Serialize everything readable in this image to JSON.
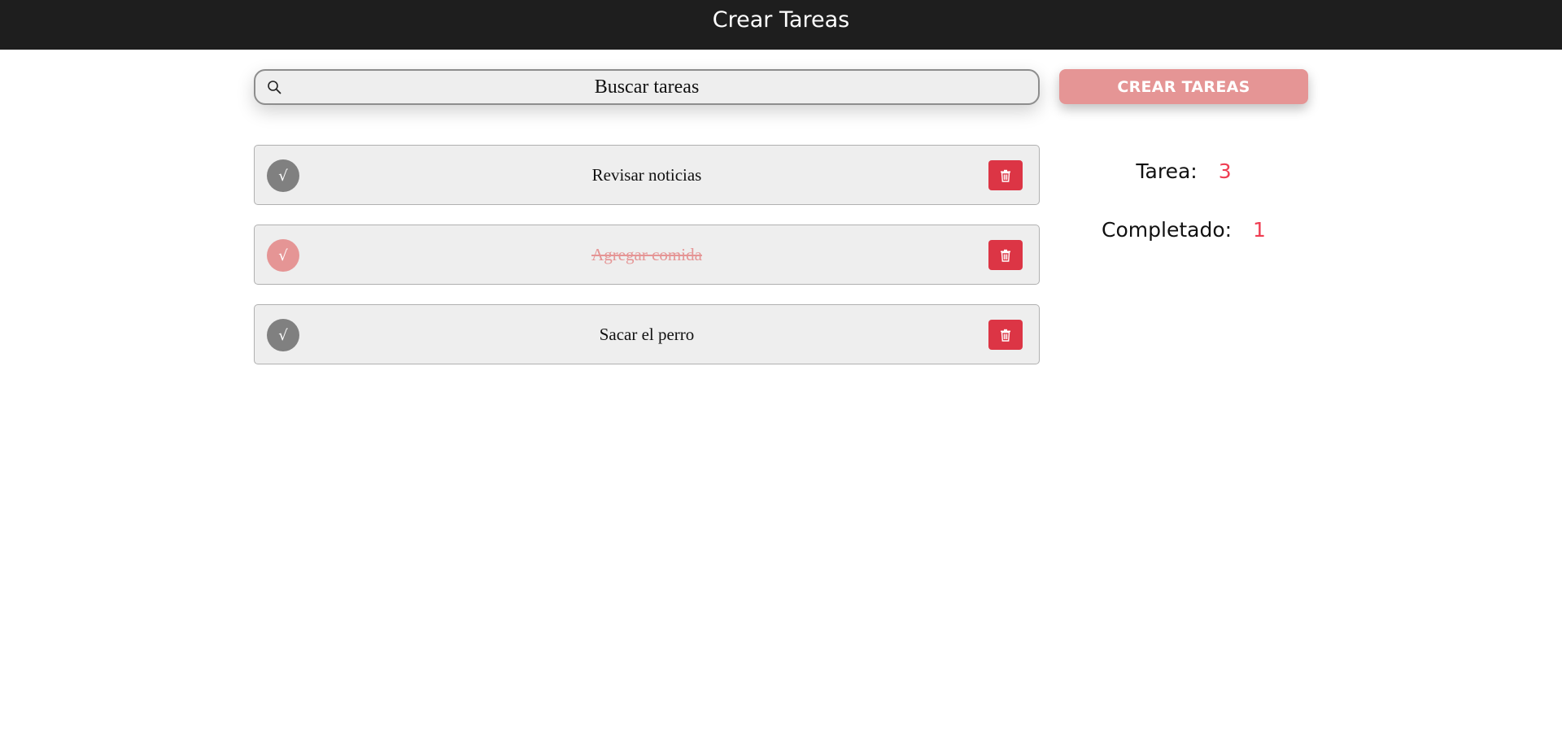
{
  "header": {
    "title": "Crear Tareas"
  },
  "search": {
    "placeholder": "Buscar tareas",
    "value": ""
  },
  "actions": {
    "create_label": "CREAR TAREAS"
  },
  "tasks": [
    {
      "text": "Revisar noticias",
      "completed": false,
      "check_glyph": "√"
    },
    {
      "text": "Agregar comida",
      "completed": true,
      "check_glyph": "√"
    },
    {
      "text": "Sacar el perro",
      "completed": false,
      "check_glyph": "√"
    }
  ],
  "stats": {
    "tasks_label": "Tarea:",
    "tasks_value": "3",
    "completed_label": "Completado:",
    "completed_value": "1"
  },
  "icons": {
    "search": "search-icon",
    "delete": "trash-icon",
    "check": "check-icon"
  },
  "colors": {
    "header_bg": "#1e1e1e",
    "accent": "#e59595",
    "delete_red": "#dc3545",
    "stat_value": "#ef3d52",
    "check_gray": "#808080"
  }
}
